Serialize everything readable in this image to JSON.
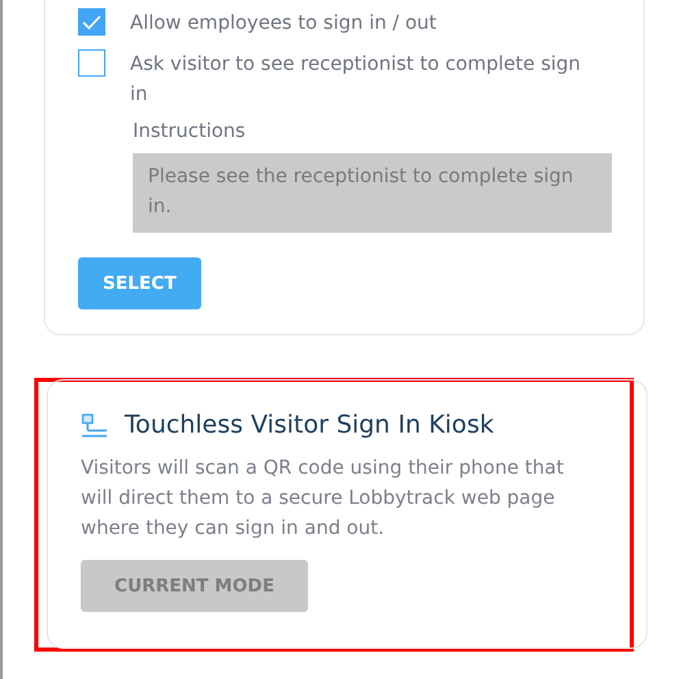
{
  "settings_card": {
    "options": [
      {
        "label": "Allow employees to sign in / out",
        "checked": true
      },
      {
        "label": "Ask visitor to see receptionist to complete sign in",
        "checked": false
      }
    ],
    "instructions": {
      "label": "Instructions",
      "value": "Please see the receptionist to complete sign in."
    },
    "button": {
      "label": "SELECT",
      "disabled": false
    }
  },
  "mode_card": {
    "title": "Touchless Visitor Sign In Kiosk",
    "highlighted": true,
    "description": "Visitors will scan a QR code using their phone that will direct them to a secure Lobbytrack web page where they can sign in and out.",
    "button": {
      "label": "CURRENT MODE",
      "disabled": true
    }
  }
}
